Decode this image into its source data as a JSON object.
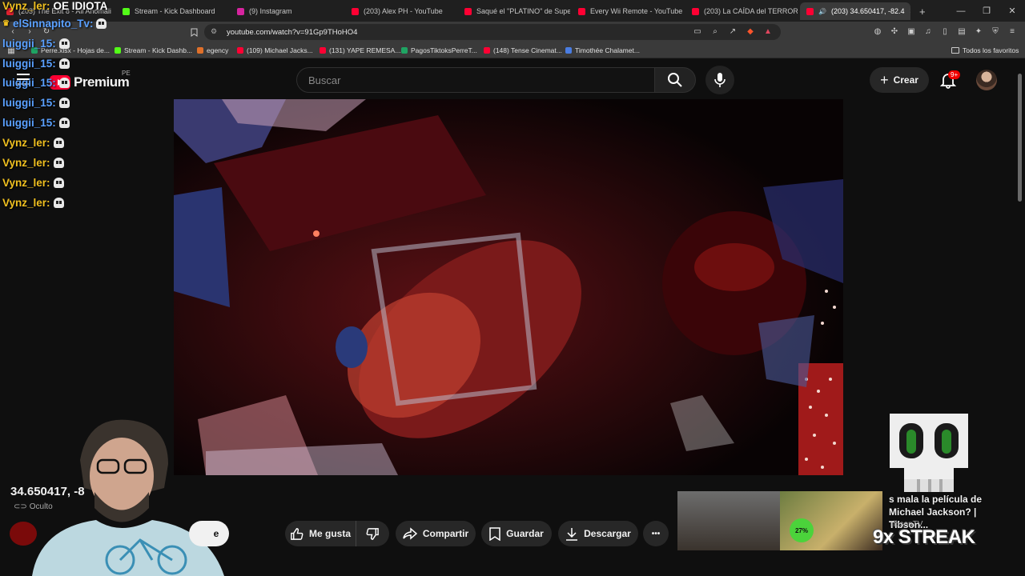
{
  "browser": {
    "tabs": [
      {
        "title": "(203) The Exit 8 - All Anomali",
        "color": "#e02030"
      },
      {
        "title": "Stream - Kick Dashboard",
        "color": "#53fc18"
      },
      {
        "title": "(9) Instagram",
        "color": "#d6249f"
      },
      {
        "title": "(203) Alex PH - YouTube",
        "color": "#ff0033"
      },
      {
        "title": "Saqué el \"PLATINO\" de Super",
        "color": "#ff0033"
      },
      {
        "title": "Every Wii Remote - YouTube",
        "color": "#ff0033"
      },
      {
        "title": "(203) La CAÍDA del TERROR en",
        "color": "#ff0033"
      },
      {
        "title": "(203) 34.650417, -82.4",
        "color": "#ff0033"
      }
    ],
    "new_tab": "+",
    "url": "youtube.com/watch?v=91Gp9THoHO4",
    "bookmarks": [
      {
        "label": "Perre.xlsx - Hojas de...",
        "color": "#1fa463"
      },
      {
        "label": "Stream - Kick Dashb...",
        "color": "#53fc18"
      },
      {
        "label": "egency",
        "color": "#e0702a"
      },
      {
        "label": "(109) Michael Jacks...",
        "color": "#ff0033"
      },
      {
        "label": "(131) YAPE REMESA...",
        "color": "#ff0033"
      },
      {
        "label": "PagosTiktoksPerreT...",
        "color": "#1fa463"
      },
      {
        "label": "(148) Tense Cinemat...",
        "color": "#ff0033"
      },
      {
        "label": "Timothée Chalamet...",
        "color": "#4a7de2"
      }
    ],
    "bookmarks_folder": "Todos los favoritos"
  },
  "youtube": {
    "logo_text": "Premium",
    "country": "PE",
    "search_placeholder": "Buscar",
    "create_label": "Crear",
    "notification_count": "9+"
  },
  "chat": [
    {
      "user": "Vynz_ler:",
      "msg": "OE IDIOTA",
      "color": "#f0c020"
    },
    {
      "user": "elSinnapito_Tv:",
      "msg": "",
      "color": "#5aa0ff"
    },
    {
      "user": "luiggii_15:",
      "msg": "",
      "color": "#5aa0ff"
    },
    {
      "user": "luiggii_15:",
      "msg": "",
      "color": "#5aa0ff"
    },
    {
      "user": "luiggii_15:",
      "msg": "",
      "color": "#5aa0ff"
    },
    {
      "user": "luiggii_15:",
      "msg": "",
      "color": "#5aa0ff"
    },
    {
      "user": "luiggii_15:",
      "msg": "",
      "color": "#5aa0ff"
    },
    {
      "user": "Vynz_ler:",
      "msg": "",
      "color": "#f0c020"
    },
    {
      "user": "Vynz_ler:",
      "msg": "",
      "color": "#f0c020"
    },
    {
      "user": "Vynz_ler:",
      "msg": "",
      "color": "#f0c020"
    },
    {
      "user": "Vynz_ler:",
      "msg": "",
      "color": "#f0c020"
    }
  ],
  "video": {
    "title": "34.650417, -8",
    "visibility": "Oculto"
  },
  "actions": {
    "like": "Me gusta",
    "share": "Compartir",
    "save": "Guardar",
    "download": "Descargar",
    "more": "•••",
    "subscribe_partial": "e"
  },
  "recommendation": {
    "title": "s mala la película de Michael Jackson? | Tibson...",
    "channel": "TibsonTV",
    "thumb_badge": "27%"
  },
  "overlay": {
    "streak": "9x STREAK"
  }
}
